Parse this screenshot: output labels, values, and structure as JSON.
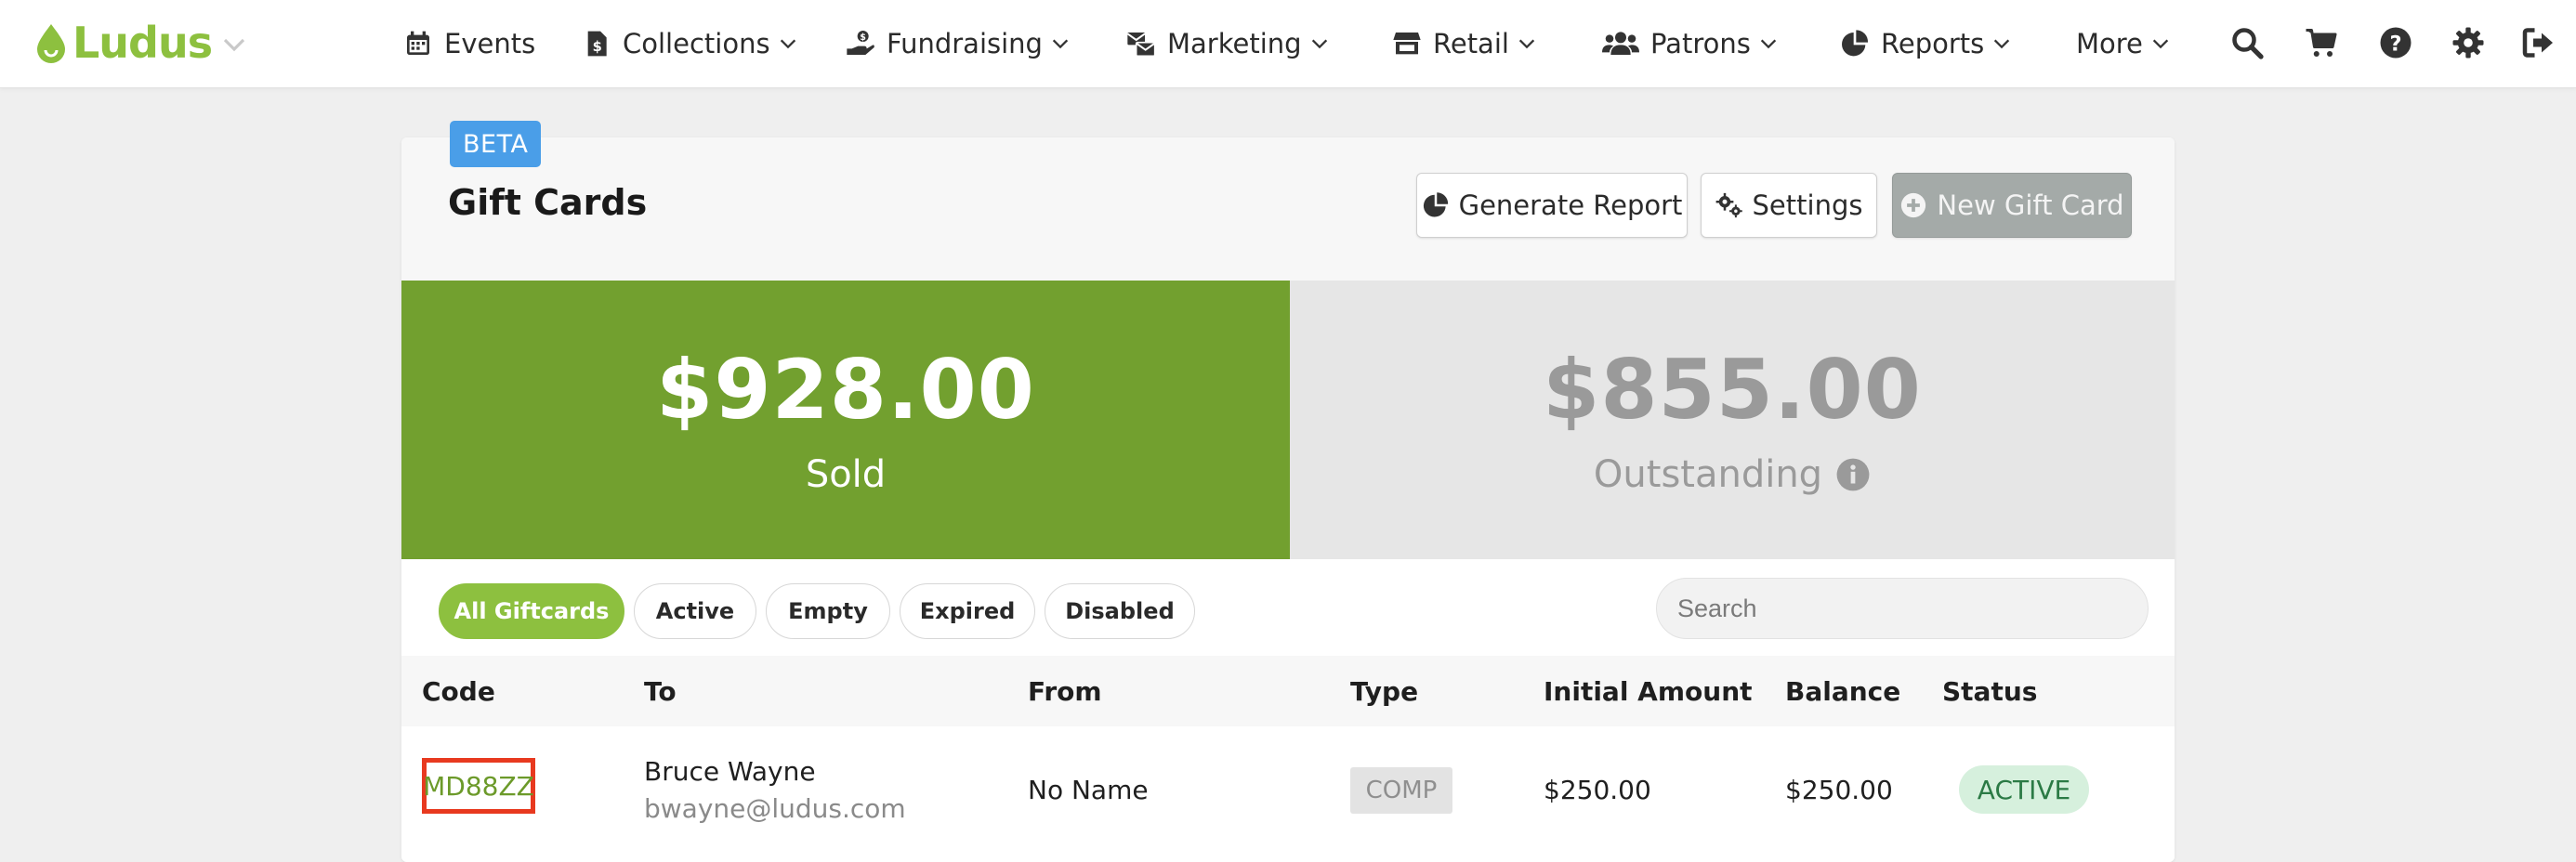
{
  "brand": {
    "name": "Ludus",
    "color": "#8dc03f"
  },
  "nav": {
    "events": "Events",
    "collections": "Collections",
    "fundraising": "Fundraising",
    "marketing": "Marketing",
    "retail": "Retail",
    "patrons": "Patrons",
    "reports": "Reports",
    "more": "More"
  },
  "header": {
    "badge": "BETA",
    "title": "Gift Cards",
    "generate_report": "Generate Report",
    "settings": "Settings",
    "new_gift_card": "New Gift Card"
  },
  "stats": {
    "sold_amount": "$928.00",
    "sold_label": "Sold",
    "outstanding_amount": "$855.00",
    "outstanding_label": "Outstanding"
  },
  "filters": {
    "all": "All Giftcards",
    "active": "Active",
    "empty": "Empty",
    "expired": "Expired",
    "disabled": "Disabled",
    "selected": "All Giftcards"
  },
  "search": {
    "placeholder": "Search"
  },
  "table": {
    "columns": {
      "code": "Code",
      "to": "To",
      "from": "From",
      "type": "Type",
      "initial_amount": "Initial Amount",
      "balance": "Balance",
      "status": "Status"
    },
    "rows": [
      {
        "code": "MD88ZZ",
        "to_name": "Bruce Wayne",
        "to_email": "bwayne@ludus.com",
        "from": "No Name",
        "type": "COMP",
        "initial_amount": "$250.00",
        "balance": "$250.00",
        "status": "ACTIVE"
      }
    ]
  },
  "colors": {
    "sold_bg": "#72a02f",
    "outstanding_bg": "#e6e6e6",
    "beta_badge": "#4a9ee8",
    "highlight_border": "#e8391f",
    "active_status_bg": "#d6f0dd"
  }
}
